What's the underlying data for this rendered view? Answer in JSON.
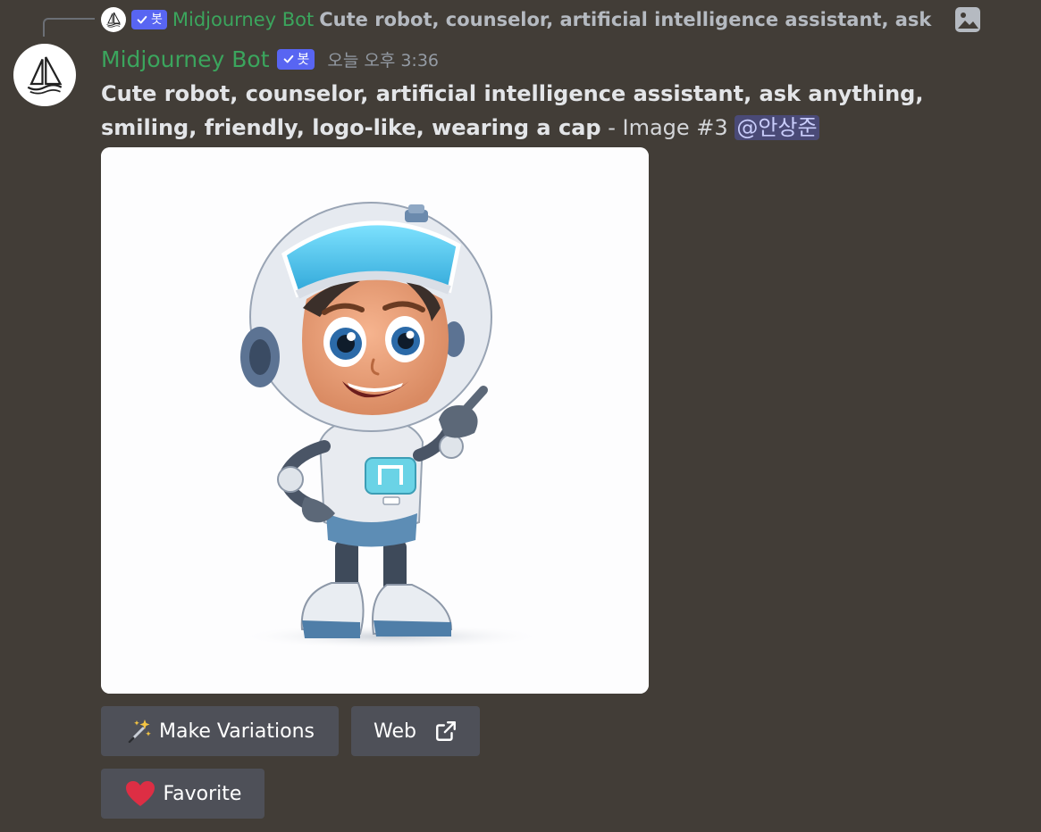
{
  "reply": {
    "author": "Midjourney Bot",
    "bot_badge": "봇",
    "text": "Cute robot, counselor, artificial intelligence assistant, ask anyth",
    "attachment_icon": "image-icon"
  },
  "message": {
    "author": "Midjourney Bot",
    "bot_badge": "봇",
    "timestamp": "오늘 오후 3:36",
    "prompt": "Cute robot, counselor, artificial intelligence assistant, ask anything, smiling, friendly, logo-like, wearing a cap",
    "suffix": " - Image #3 ",
    "mention": "@안상준",
    "avatar_icon": "midjourney-sailboat-icon"
  },
  "buttons": {
    "make_variations": "Make Variations",
    "web": "Web",
    "favorite": "Favorite"
  },
  "colors": {
    "background": "#423d37",
    "author": "#3ba55d",
    "badge": "#5865f2",
    "button": "#4e5058",
    "heart": "#e0245e"
  }
}
